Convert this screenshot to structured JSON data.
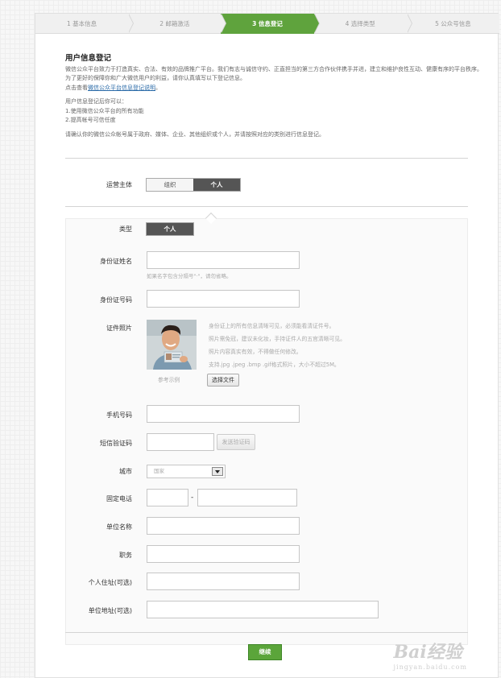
{
  "steps": [
    "1 基本信息",
    "2 邮箱激活",
    "3 信息登记",
    "4 选择类型",
    "5 公众号信息"
  ],
  "intro": {
    "title": "用户信息登记",
    "para1": "微信公众平台致力于打造真实、合法、有效的品牌推广平台。我们有志与诚信守约、正直担当的第三方合作伙伴携手并进，建立和维护良性互动、健康有序的平台秩序。为了更好的保障你和广大微信用户的利益，请你认真填写以下登记信息。",
    "link_prefix": "点击查看",
    "link": "微信公众平台信息登记说明",
    "link_suffix": "。",
    "after_title": "用户信息登记后你可以：",
    "item1": "1.使用微信公众平台的所有功能",
    "item2": "2.提高帐号可信任度",
    "confirm": "请确认你的微信公众帐号属于政府、媒体、企业、其他组织或个人，并请按照对应的类别进行信息登记。"
  },
  "form": {
    "subject_label": "运营主体",
    "subject_opt_org": "组织",
    "subject_opt_person": "个人",
    "type_label": "类型",
    "type_value": "个人",
    "id_name_label": "身份证姓名",
    "id_name_hint": "如果名字包含分隔号\"·\"，请勿省略。",
    "id_number_label": "身份证号码",
    "photo_label": "证件照片",
    "photo_caption": "参考示例",
    "photo_desc": [
      "身份证上的所有信息清晰可见，必须能看清证件号。",
      "照片需免冠，建议未化妆，手持证件人的五官清晰可见。",
      "照片内容真实有效，不得做任何修改。",
      "支持.jpg .jpeg .bmp .gif格式照片，大小不超过5M。"
    ],
    "choose_file": "选择文件",
    "phone_label": "手机号码",
    "sms_label": "短信验证码",
    "send_code": "发送验证码",
    "city_label": "城市",
    "city_value": "国家",
    "tel_label": "固定电话",
    "tel_sep": "-",
    "company_label": "单位名称",
    "position_label": "职务",
    "home_addr_label": "个人住址(可选)",
    "work_addr_label": "单位地址(可选)"
  },
  "submit": "继续",
  "watermark": {
    "brand": "Bai经验",
    "url": "jingyan.baidu.com"
  },
  "colors": {
    "accent": "#5fa33d"
  }
}
